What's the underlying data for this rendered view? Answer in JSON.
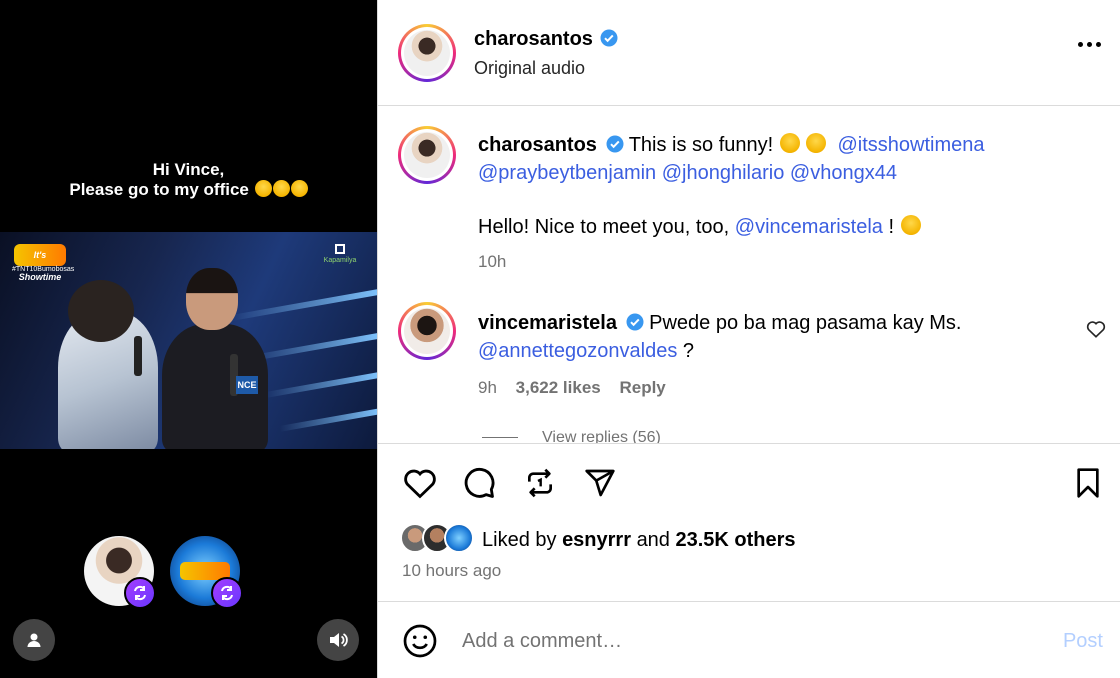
{
  "video": {
    "caption_line1": "Hi Vince,",
    "caption_line2": "Please go to my office",
    "brand_logo_text": "It's Showtime",
    "hashtag": "#TNT10Bumobosas",
    "network_label": "Kapamilya",
    "mic_flag_text": "NCE"
  },
  "header": {
    "username": "charosantos",
    "audio": "Original audio"
  },
  "caption": {
    "username": "charosantos",
    "text": "This is so funny!",
    "mentions": [
      "@itsshowtimena",
      "@praybeytbenjamin",
      "@jhonghilario",
      "@vhongx44"
    ],
    "line2_prefix": "Hello! Nice to meet you, too,",
    "line2_mention": "@vincemaristela",
    "line2_suffix": "!",
    "time": "10h"
  },
  "comment1": {
    "username": "vincemaristela",
    "text": "Pwede po ba mag pasama kay Ms.",
    "mention": "@annettegozonvaldes",
    "suffix": "?",
    "time": "9h",
    "likes": "3,622 likes",
    "reply": "Reply",
    "view_replies": "View replies (56)"
  },
  "likes": {
    "prefix": "Liked by",
    "user": "esnyrrr",
    "middle": "and",
    "others": "23.5K others",
    "time_ago": "10 hours ago"
  },
  "add_comment": {
    "placeholder": "Add a comment…",
    "post_label": "Post"
  },
  "colors": {
    "mention": "#3b5ee0",
    "post_disabled": "#b3cfff",
    "verified": "#3897f0",
    "remix_badge": "#7b3cff"
  },
  "icons": [
    "heart-icon",
    "comment-icon",
    "repost-icon",
    "share-icon",
    "bookmark-icon",
    "more-icon",
    "emoji-icon",
    "profile-icon",
    "volume-icon",
    "verified-icon",
    "remix-icon"
  ]
}
